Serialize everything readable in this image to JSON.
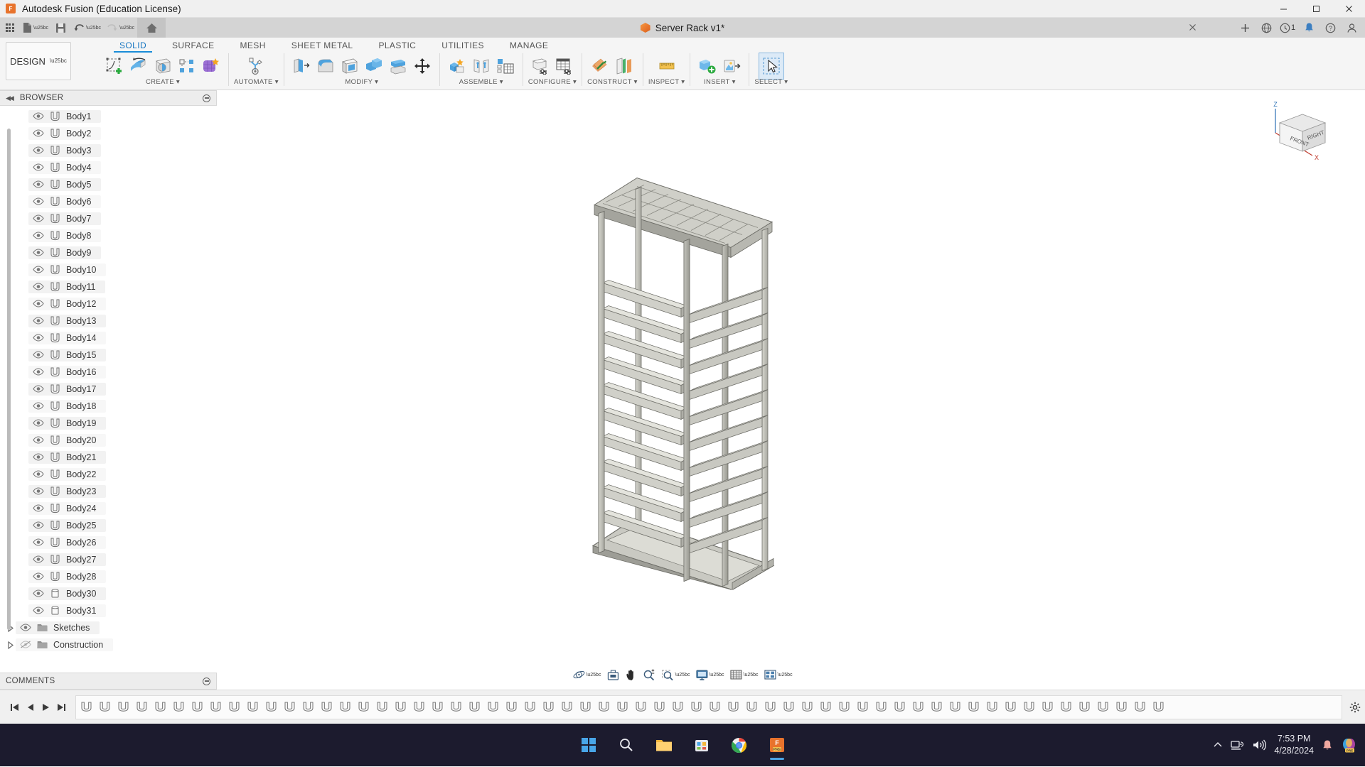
{
  "titlebar": {
    "app_title": "Autodesk Fusion (Education License)",
    "logo_text": "F",
    "minimize": "─",
    "maximize": "□",
    "close": "✕"
  },
  "quick_access": {
    "items": [
      {
        "name": "app-grid",
        "icon": "grid-icon",
        "label": ""
      },
      {
        "name": "new-file",
        "icon": "file-icon",
        "label": "",
        "caret": true
      },
      {
        "name": "save",
        "icon": "save-icon",
        "label": ""
      },
      {
        "name": "undo",
        "icon": "undo-icon",
        "label": "",
        "caret": true
      },
      {
        "name": "redo",
        "icon": "redo-icon",
        "label": "",
        "caret": true
      },
      {
        "name": "home",
        "icon": "home-icon",
        "label": ""
      }
    ],
    "document_tab": {
      "title": "Server Rack v1*",
      "close": "✕"
    },
    "right_items": [
      {
        "name": "add-tab",
        "icon": "plus-icon",
        "label": "+"
      },
      {
        "name": "help-globe",
        "icon": "globe-icon",
        "label": ""
      },
      {
        "name": "job-status",
        "icon": "clock-icon",
        "label": "1"
      },
      {
        "name": "notifications",
        "icon": "bell-icon",
        "label": ""
      },
      {
        "name": "help",
        "icon": "question-icon",
        "label": ""
      },
      {
        "name": "account",
        "icon": "user-icon",
        "label": ""
      }
    ]
  },
  "ribbon": {
    "workspace_selector": "DESIGN",
    "workspace_caret": "▼",
    "tabs": [
      {
        "label": "SOLID",
        "active": true
      },
      {
        "label": "SURFACE",
        "active": false
      },
      {
        "label": "MESH",
        "active": false
      },
      {
        "label": "SHEET METAL",
        "active": false
      },
      {
        "label": "PLASTIC",
        "active": false
      },
      {
        "label": "UTILITIES",
        "active": false
      },
      {
        "label": "MANAGE",
        "active": false
      }
    ],
    "panels": [
      {
        "label": "CREATE ▾",
        "tools": [
          {
            "name": "create-sketch-tool",
            "icon": "sketch-plus-icon"
          },
          {
            "name": "extrude-tool",
            "icon": "extrude-icon"
          },
          {
            "name": "revolve-tool",
            "icon": "revolve-icon"
          },
          {
            "name": "pattern-tool",
            "icon": "pattern-icon"
          },
          {
            "name": "form-tool",
            "icon": "form-icon"
          }
        ]
      },
      {
        "label": "AUTOMATE ▾",
        "tools": [
          {
            "name": "automated-modeling-tool",
            "icon": "automate-icon"
          }
        ]
      },
      {
        "label": "MODIFY ▾",
        "tools": [
          {
            "name": "press-pull-tool",
            "icon": "presspull-icon"
          },
          {
            "name": "fillet-tool",
            "icon": "fillet-icon"
          },
          {
            "name": "shell-tool",
            "icon": "shell-icon"
          },
          {
            "name": "combine-tool",
            "icon": "combine-icon"
          },
          {
            "name": "split-body-tool",
            "icon": "split-icon"
          },
          {
            "name": "move-copy-tool",
            "icon": "move-icon"
          }
        ]
      },
      {
        "label": "ASSEMBLE ▾",
        "tools": [
          {
            "name": "new-component-tool",
            "icon": "new-component-icon"
          },
          {
            "name": "joint-tool",
            "icon": "joint-icon"
          },
          {
            "name": "contact-sets-tool",
            "icon": "contact-sets-icon"
          }
        ]
      },
      {
        "label": "CONFIGURE ▾",
        "tools": [
          {
            "name": "configure-model-tool",
            "icon": "configure-model-icon"
          },
          {
            "name": "configuration-table-tool",
            "icon": "configuration-table-icon"
          }
        ]
      },
      {
        "label": "CONSTRUCT ▾",
        "tools": [
          {
            "name": "offset-plane-tool",
            "icon": "offset-plane-icon"
          },
          {
            "name": "plane-at-angle-tool",
            "icon": "plane-angle-icon"
          }
        ]
      },
      {
        "label": "INSPECT ▾",
        "tools": [
          {
            "name": "measure-tool",
            "icon": "measure-icon"
          }
        ]
      },
      {
        "label": "INSERT ▾",
        "tools": [
          {
            "name": "insert-derive-tool",
            "icon": "insert-derive-icon"
          },
          {
            "name": "decal-tool",
            "icon": "decal-icon"
          }
        ]
      },
      {
        "label": "SELECT ▾",
        "tools": [
          {
            "name": "select-tool",
            "icon": "select-cursor-icon"
          }
        ]
      }
    ]
  },
  "browser": {
    "header": "BROWSER",
    "collapse_icon": "◀◀",
    "nodes": [
      {
        "label": "Body1",
        "icon": "body-icon",
        "visible": true
      },
      {
        "label": "Body2",
        "icon": "body-icon",
        "visible": true
      },
      {
        "label": "Body3",
        "icon": "body-icon",
        "visible": true
      },
      {
        "label": "Body4",
        "icon": "body-icon",
        "visible": true
      },
      {
        "label": "Body5",
        "icon": "body-icon",
        "visible": true
      },
      {
        "label": "Body6",
        "icon": "body-icon",
        "visible": true
      },
      {
        "label": "Body7",
        "icon": "body-icon",
        "visible": true
      },
      {
        "label": "Body8",
        "icon": "body-icon",
        "visible": true
      },
      {
        "label": "Body9",
        "icon": "body-icon",
        "visible": true
      },
      {
        "label": "Body10",
        "icon": "body-icon",
        "visible": true
      },
      {
        "label": "Body11",
        "icon": "body-icon",
        "visible": true
      },
      {
        "label": "Body12",
        "icon": "body-icon",
        "visible": true
      },
      {
        "label": "Body13",
        "icon": "body-icon",
        "visible": true
      },
      {
        "label": "Body14",
        "icon": "body-icon",
        "visible": true
      },
      {
        "label": "Body15",
        "icon": "body-icon",
        "visible": true
      },
      {
        "label": "Body16",
        "icon": "body-icon",
        "visible": true
      },
      {
        "label": "Body17",
        "icon": "body-icon",
        "visible": true
      },
      {
        "label": "Body18",
        "icon": "body-icon",
        "visible": true
      },
      {
        "label": "Body19",
        "icon": "body-icon",
        "visible": true
      },
      {
        "label": "Body20",
        "icon": "body-icon",
        "visible": true
      },
      {
        "label": "Body21",
        "icon": "body-icon",
        "visible": true
      },
      {
        "label": "Body22",
        "icon": "body-icon",
        "visible": true
      },
      {
        "label": "Body23",
        "icon": "body-icon",
        "visible": true
      },
      {
        "label": "Body24",
        "icon": "body-icon",
        "visible": true
      },
      {
        "label": "Body25",
        "icon": "body-icon",
        "visible": true
      },
      {
        "label": "Body26",
        "icon": "body-icon",
        "visible": true
      },
      {
        "label": "Body27",
        "icon": "body-icon",
        "visible": true
      },
      {
        "label": "Body28",
        "icon": "body-icon",
        "visible": true
      },
      {
        "label": "Body30",
        "icon": "cylinder-body-icon",
        "visible": true
      },
      {
        "label": "Body31",
        "icon": "cylinder-body-icon",
        "visible": true
      }
    ],
    "folders": [
      {
        "label": "Sketches",
        "icon": "folder-icon",
        "visible": true,
        "expanded": false
      },
      {
        "label": "Construction",
        "icon": "folder-icon",
        "visible": false,
        "expanded": false
      }
    ]
  },
  "comments": {
    "header": "COMMENTS"
  },
  "viewcube": {
    "axis_z": "Z",
    "axis_x": "X",
    "face_front": "FRONT",
    "face_right": "RIGHT"
  },
  "navbar": {
    "items": [
      {
        "name": "orbit-button",
        "icon": "orbit-icon",
        "caret": true
      },
      {
        "name": "look-at-button",
        "icon": "look-at-icon",
        "caret": false
      },
      {
        "name": "pan-button",
        "icon": "pan-hand-icon",
        "caret": false
      },
      {
        "name": "zoom-button",
        "icon": "zoom-magnifier-icon",
        "caret": false
      },
      {
        "name": "zoom-window-button",
        "icon": "zoom-window-icon",
        "caret": true
      },
      {
        "name": "display-settings-button",
        "icon": "monitor-icon",
        "caret": true
      },
      {
        "name": "grid-snaps-button",
        "icon": "grid-icon",
        "caret": true
      },
      {
        "name": "viewports-button",
        "icon": "viewports-icon",
        "caret": true
      }
    ]
  },
  "timeline": {
    "controls": [
      {
        "name": "timeline-start-button",
        "icon": "skip-start-icon"
      },
      {
        "name": "timeline-prev-button",
        "icon": "step-back-icon"
      },
      {
        "name": "timeline-play-button",
        "icon": "play-icon"
      },
      {
        "name": "timeline-end-button",
        "icon": "skip-end-icon"
      }
    ],
    "feature_count": 59,
    "right_controls": [
      {
        "name": "timeline-settings-button",
        "icon": "gear-icon"
      }
    ]
  },
  "taskbar": {
    "apps": [
      {
        "name": "start-button",
        "icon": "windows-icon",
        "active": false
      },
      {
        "name": "search-button",
        "icon": "search-icon",
        "active": false
      },
      {
        "name": "file-explorer-button",
        "icon": "folder-icon",
        "active": false
      },
      {
        "name": "store-button",
        "icon": "store-icon",
        "active": false
      },
      {
        "name": "chrome-button",
        "icon": "chrome-icon",
        "active": false
      },
      {
        "name": "fusion-button",
        "icon": "fusion-icon",
        "active": true
      }
    ],
    "tray": {
      "chevron": "⌃",
      "network_icon": "network-icon",
      "volume_icon": "volume-icon",
      "time": "7:53 PM",
      "date": "4/28/2024",
      "notification_icon": "bell-icon",
      "copilot_icon": "copilot-icon",
      "copilot_badge": "PRE"
    }
  },
  "colors": {
    "accent": "#1a8cd8",
    "brand_orange": "#e8732c",
    "taskbar_bg": "#1c1b2e",
    "ribbon_bg": "#f5f5f5",
    "qab_bg": "#d4d4d4"
  }
}
